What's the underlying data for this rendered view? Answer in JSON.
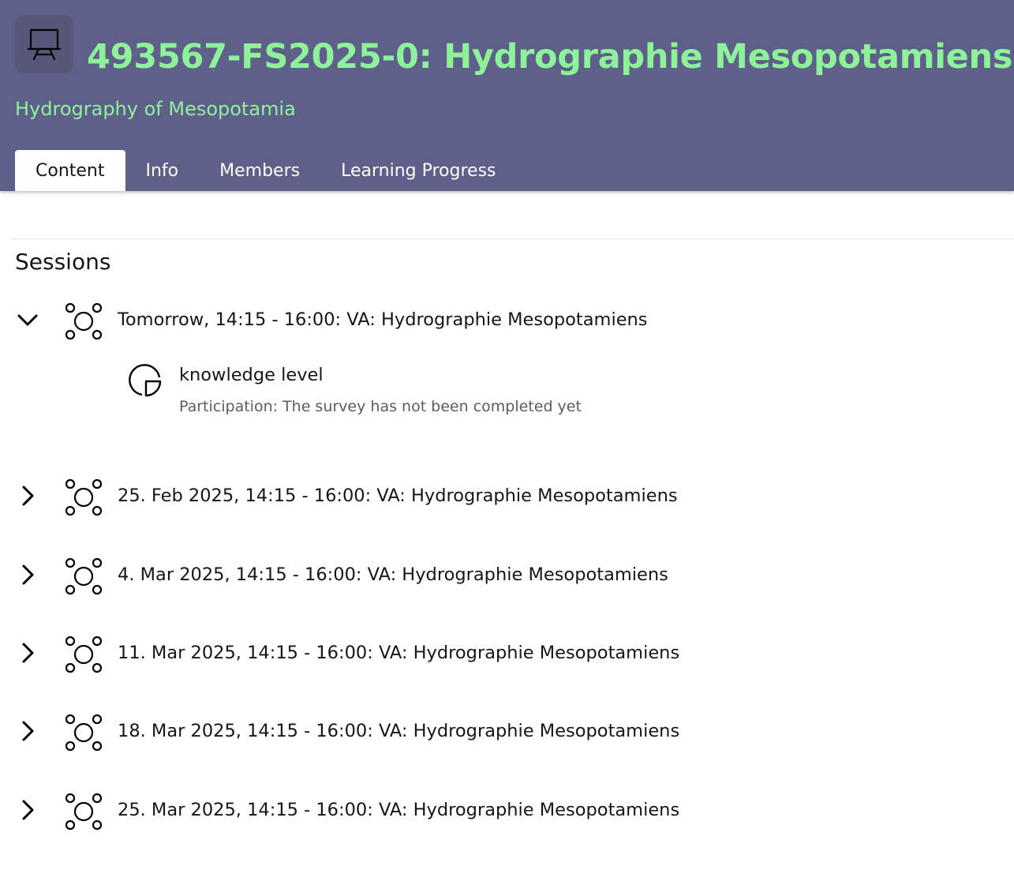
{
  "header": {
    "title": "493567-FS2025-0: Hydrographie Mesopotamiens",
    "subtitle": "Hydrography of Mesopotamia",
    "icon": "presentation-board-icon",
    "colors": {
      "background": "#5f6089",
      "title": "#8ef29a"
    }
  },
  "tabs": [
    {
      "label": "Content",
      "active": true
    },
    {
      "label": "Info",
      "active": false
    },
    {
      "label": "Members",
      "active": false
    },
    {
      "label": "Learning Progress",
      "active": false
    }
  ],
  "main": {
    "section_title": "Sessions",
    "sessions": [
      {
        "label": "Tomorrow, 14:15 - 16:00: VA: Hydrographie Mesopotamiens",
        "expanded": true
      },
      {
        "label": "25. Feb 2025, 14:15 - 16:00: VA: Hydrographie Mesopotamiens",
        "expanded": false
      },
      {
        "label": "4. Mar 2025, 14:15 - 16:00: VA: Hydrographie Mesopotamiens",
        "expanded": false
      },
      {
        "label": "11. Mar 2025, 14:15 - 16:00: VA: Hydrographie Mesopotamiens",
        "expanded": false
      },
      {
        "label": "18. Mar 2025, 14:15 - 16:00: VA: Hydrographie Mesopotamiens",
        "expanded": false
      },
      {
        "label": "25. Mar 2025, 14:15 - 16:00: VA: Hydrographie Mesopotamiens",
        "expanded": false
      }
    ],
    "session_item": {
      "title": "knowledge level",
      "status": "Participation: The survey has not been completed yet",
      "icon": "survey-pie-icon"
    }
  }
}
